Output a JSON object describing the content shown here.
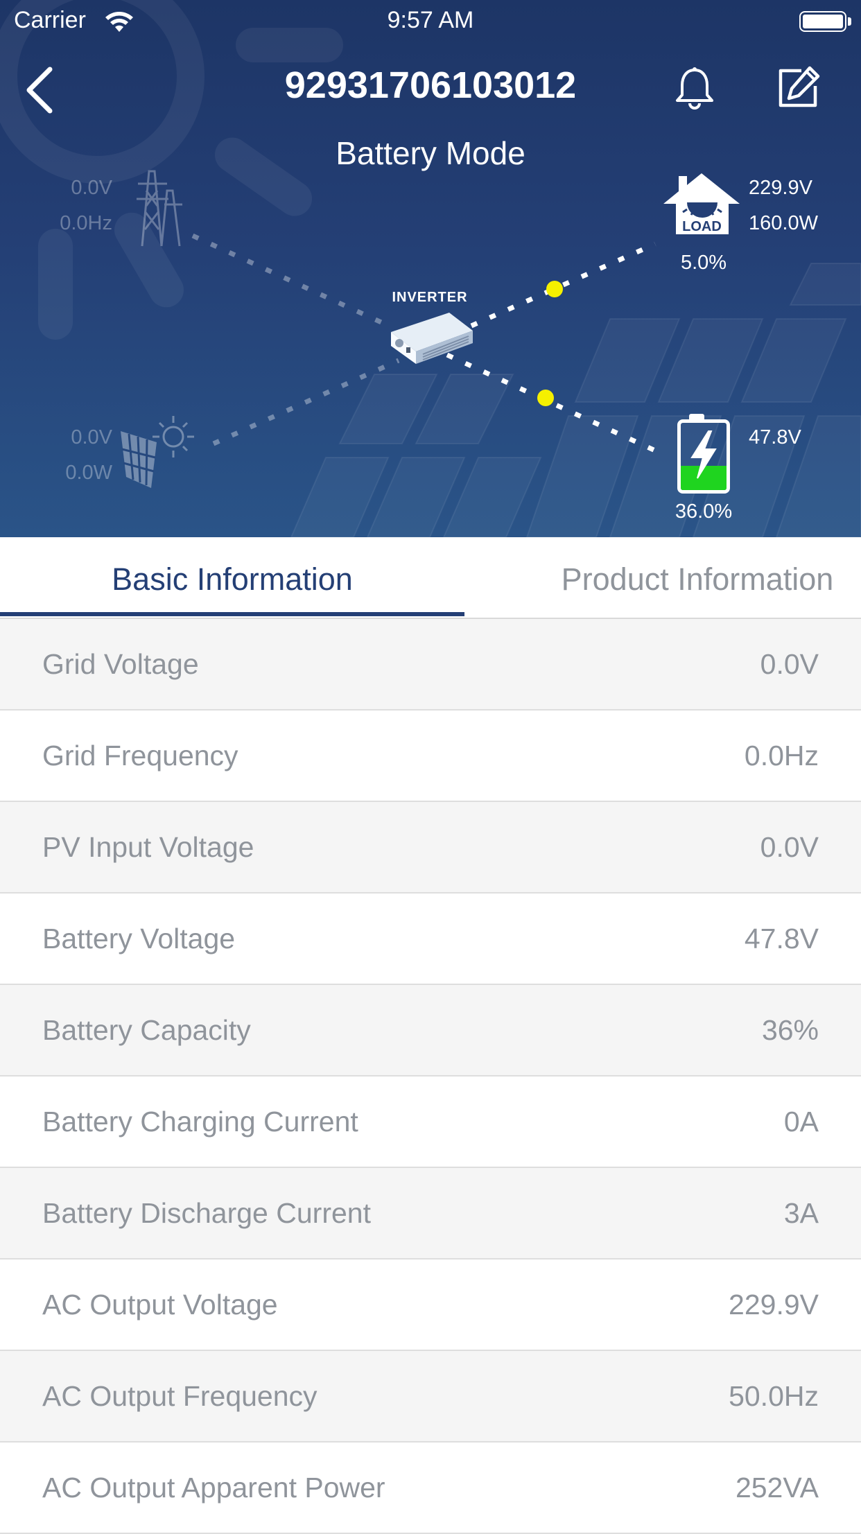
{
  "status_bar": {
    "carrier": "Carrier",
    "time": "9:57 AM"
  },
  "header": {
    "title": "92931706103012",
    "mode": "Battery Mode"
  },
  "diagram": {
    "grid": {
      "voltage": "0.0V",
      "frequency": "0.0Hz"
    },
    "pv": {
      "voltage": "0.0V",
      "power": "0.0W"
    },
    "inverter_label": "INVERTER",
    "load": {
      "icon_label": "LOAD",
      "voltage": "229.9V",
      "power": "160.0W",
      "percent": "5.0%"
    },
    "battery": {
      "voltage": "47.8V",
      "percent": "36.0%",
      "level": 0.36
    },
    "colors": {
      "flow_dot": "#f5f000",
      "battery_fill": "#1fd41f"
    }
  },
  "tabs": [
    {
      "label": "Basic Information",
      "active": true
    },
    {
      "label": "Product Information",
      "active": false
    }
  ],
  "rows": [
    {
      "label": "Grid Voltage",
      "value": "0.0V"
    },
    {
      "label": "Grid Frequency",
      "value": "0.0Hz"
    },
    {
      "label": "PV Input Voltage",
      "value": "0.0V"
    },
    {
      "label": "Battery Voltage",
      "value": "47.8V"
    },
    {
      "label": "Battery Capacity",
      "value": "36%"
    },
    {
      "label": "Battery Charging Current",
      "value": "0A"
    },
    {
      "label": "Battery Discharge Current",
      "value": "3A"
    },
    {
      "label": "AC Output Voltage",
      "value": "229.9V"
    },
    {
      "label": "AC Output Frequency",
      "value": "50.0Hz"
    },
    {
      "label": "AC Output Apparent Power",
      "value": "252VA"
    }
  ]
}
